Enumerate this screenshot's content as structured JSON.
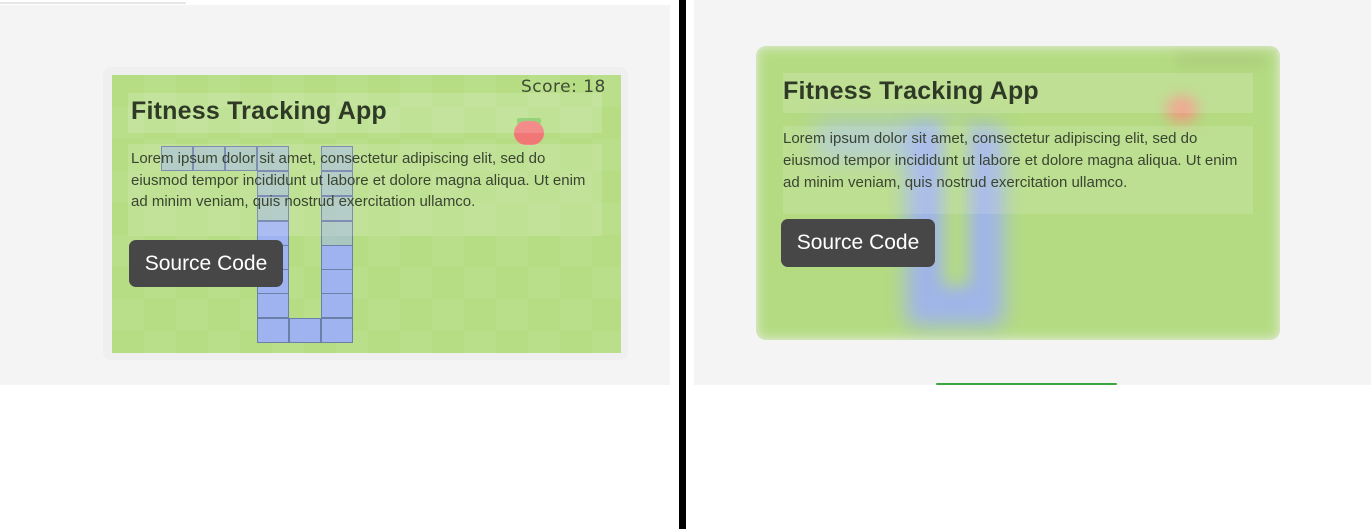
{
  "left_card": {
    "score_text": "Score: 18",
    "title": "Fitness Tracking App",
    "description": "Lorem ipsum dolor sit amet, consectetur adipiscing elit, sed do eiusmod tempor incididunt ut labore et dolore magna aliqua. Ut enim ad minim veniam, quis nostrud exercitation ullamco.",
    "button_label": "Source Code"
  },
  "right_card": {
    "title": "Fitness Tracking App",
    "description": "Lorem ipsum dolor sit amet, consectetur adipiscing elit, sed do eiusmod tempor incididunt ut labore et dolore magna aliqua. Ut enim ad minim veniam, quis nostrud exercitation ullamco.",
    "button_label": "Source Code"
  },
  "colors": {
    "board_green": "#b6dd84",
    "snake_blue": "#9fb3f1",
    "apple_red": "#f07775",
    "button_dark": "#474747",
    "accent_green": "#3aa63f"
  },
  "icons": {
    "apple": "apple-icon"
  }
}
